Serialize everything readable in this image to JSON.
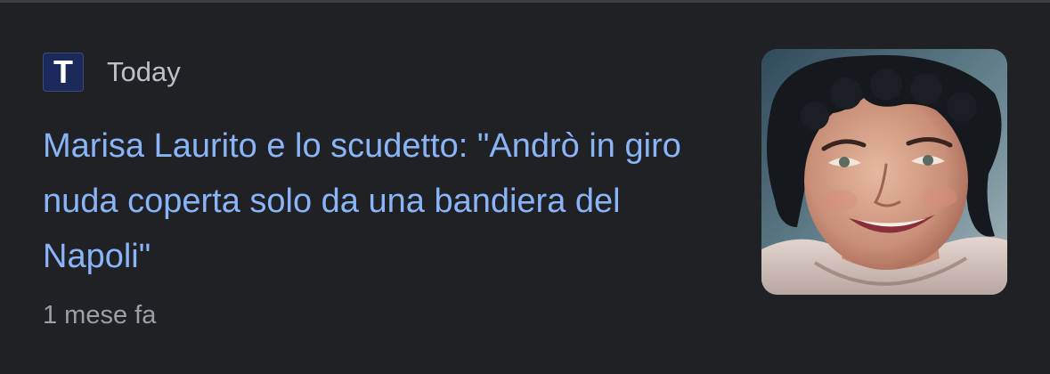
{
  "article": {
    "source": {
      "logo_letter": "T",
      "name": "Today"
    },
    "headline": "Marisa Laurito e lo scudetto: \"Andrò in giro nuda coperta solo da una bandiera del Napoli\"",
    "time_ago": "1 mese fa",
    "thumbnail": {
      "subject": "portrait of a smiling woman with dark curly hair"
    }
  },
  "colors": {
    "background": "#202124",
    "headline": "#8ab4f8",
    "source_text": "#bdc1c6",
    "timestamp": "#9aa0a6",
    "logo_bg": "#1c2a5b"
  }
}
